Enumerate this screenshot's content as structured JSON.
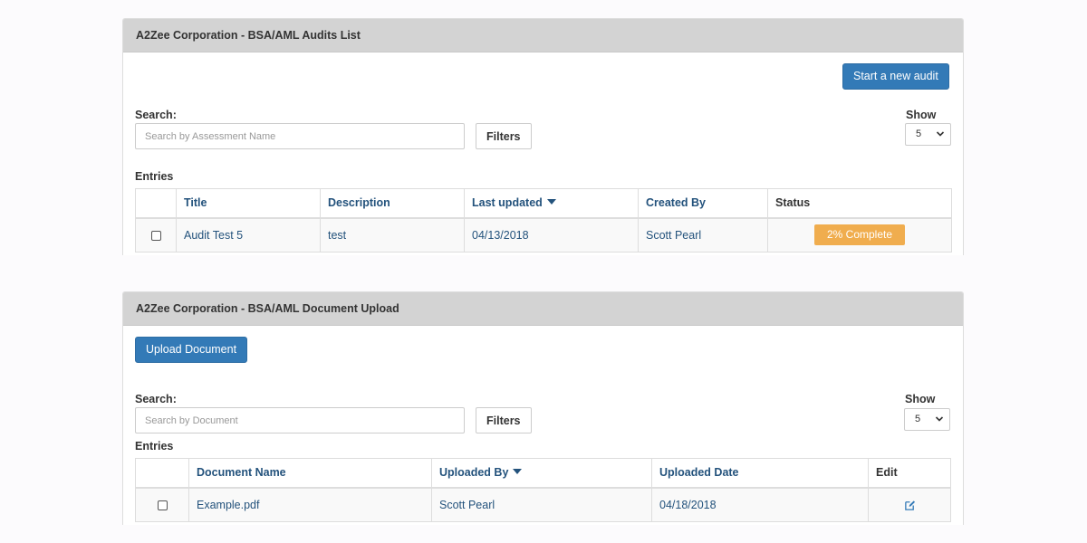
{
  "audits": {
    "title": "A2Zee Corporation - BSA/AML Audits List",
    "start_button": "Start a new audit",
    "search_label": "Search:",
    "search_placeholder": "Search by Assessment Name",
    "filters_label": "Filters",
    "show_label": "Show",
    "show_value": "5",
    "entries_label": "Entries",
    "columns": {
      "title": "Title",
      "description": "Description",
      "last_updated": "Last updated",
      "created_by": "Created By",
      "status": "Status"
    },
    "rows": [
      {
        "title": "Audit Test 5",
        "description": "test",
        "last_updated": "04/13/2018",
        "created_by": "Scott Pearl",
        "status": "2% Complete",
        "progress_percent": 2
      }
    ]
  },
  "documents": {
    "title": "A2Zee Corporation - BSA/AML Document Upload",
    "upload_button": "Upload Document",
    "search_label": "Search:",
    "search_placeholder": "Search by Document",
    "filters_label": "Filters",
    "show_label": "Show",
    "show_value": "5",
    "entries_label": "Entries",
    "columns": {
      "document_name": "Document Name",
      "uploaded_by": "Uploaded By",
      "uploaded_date": "Uploaded Date",
      "edit": "Edit"
    },
    "rows": [
      {
        "document_name": "Example.pdf",
        "uploaded_by": "Scott Pearl",
        "uploaded_date": "04/18/2018",
        "edit_icon": "edit-icon"
      }
    ]
  },
  "colors": {
    "primary": "#337ab7",
    "link": "#23527c",
    "warning": "#f0ad4e",
    "panel_heading": "#d3d3d3"
  }
}
